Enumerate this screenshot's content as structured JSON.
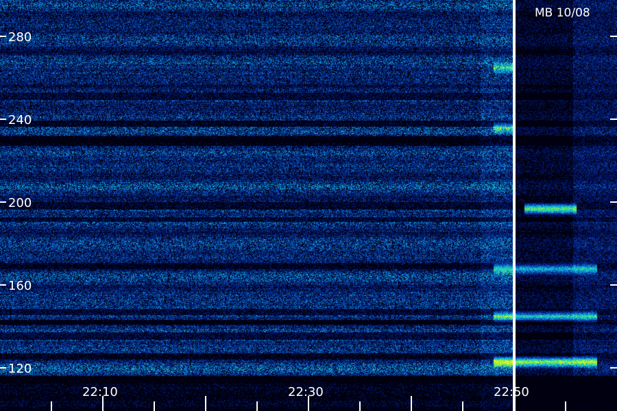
{
  "chart_data": {
    "type": "heatmap",
    "title": "MB 10/08",
    "xlabel": "",
    "ylabel": "",
    "x_ticks": [
      "22:10",
      "22:30",
      "22:50"
    ],
    "y_ticks": [
      120,
      160,
      200,
      240,
      280
    ],
    "x_range_minutes": [
      "22:08",
      "22:58"
    ],
    "y_range": [
      114,
      291
    ],
    "marker_time": "22:50",
    "colormap": [
      "#000010",
      "#04186e",
      "#0a4fb4",
      "#10a8d8",
      "#24d8b0",
      "#7cf04a",
      "#f0f018"
    ],
    "emission_bands": [
      {
        "freq": 123,
        "start": "22:48",
        "end": "22:58",
        "level": 0.9
      },
      {
        "freq": 197,
        "start": "22:51",
        "end": "22:56",
        "level": 0.85
      },
      {
        "freq": 168,
        "start": "22:48",
        "end": "22:58",
        "level": 0.6
      },
      {
        "freq": 145,
        "start": "22:48",
        "end": "22:58",
        "level": 0.6
      },
      {
        "freq": 236,
        "start": "22:48",
        "end": "22:50",
        "level": 0.55
      },
      {
        "freq": 265,
        "start": "22:48",
        "end": "22:50",
        "level": 0.5
      }
    ]
  },
  "header": {
    "station_label": "MB 10/08"
  },
  "axis": {
    "x_labels": [
      "22:10",
      "22:30",
      "22:50"
    ],
    "y_labels": [
      "120",
      "160",
      "200",
      "240",
      "280"
    ]
  },
  "colors": {
    "background": "#000000",
    "text": "#ffffff",
    "marker": "#ffffff"
  }
}
